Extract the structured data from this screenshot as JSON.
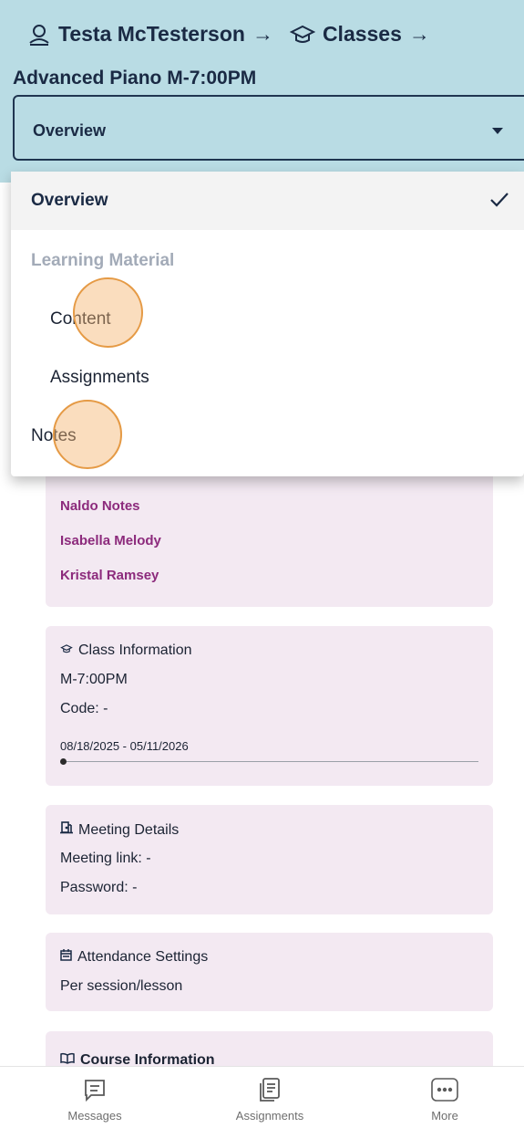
{
  "breadcrumb": {
    "student": "Testa McTesterson",
    "arrow": "→",
    "section": "Classes",
    "class_title": "Advanced Piano M-7:00PM"
  },
  "view_select": {
    "value": "Overview"
  },
  "dropdown": {
    "selected": "Overview",
    "group_header": "Learning Material",
    "items": [
      "Content",
      "Assignments",
      "Notes"
    ]
  },
  "teachers": [
    "Naldo Notes",
    "Isabella Melody",
    "Kristal Ramsey"
  ],
  "class_info": {
    "title": "Class Information",
    "schedule": "M-7:00PM",
    "code": "Code: -",
    "date_range": "08/18/2025 - 05/11/2026",
    "progress_fraction": 0.0
  },
  "meeting": {
    "title": "Meeting Details",
    "link": "Meeting link:  -",
    "password": "Password: -"
  },
  "attendance": {
    "title": "Attendance Settings",
    "mode": "Per session/lesson"
  },
  "course": {
    "title": "Course Information"
  },
  "bottom_nav": {
    "messages": "Messages",
    "assignments": "Assignments",
    "more": "More"
  },
  "colors": {
    "header_bg": "#b9dce4",
    "card_bg": "#f3e9f2",
    "link": "#8c2a7c",
    "muted": "#a3abb8"
  }
}
